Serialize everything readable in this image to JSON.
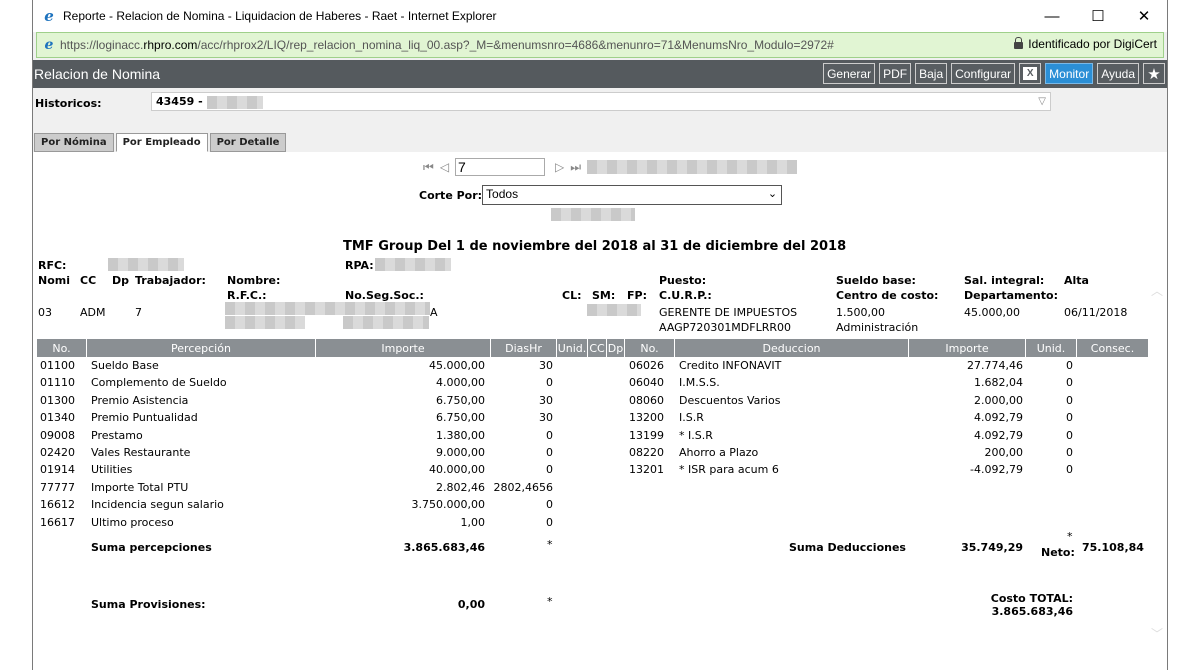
{
  "window": {
    "title": "Reporte - Relacion de Nomina - Liquidacion de Haberes - Raet - Internet Explorer",
    "url_prefix": "https://loginacc.",
    "url_domain": "rhpro.com",
    "url_rest": "/acc/rhprox2/LIQ/rep_relacion_nomina_liq_00.asp?_M=&menumsnro=4686&menunro=71&MenumsNro_Modulo=2972#",
    "secure_label": "Identificado por DigiCert",
    "minimize": "—",
    "maximize": "☐",
    "close": "✕"
  },
  "header": {
    "title": "Relacion de Nomina",
    "buttons": {
      "generar": "Generar",
      "pdf": "PDF",
      "baja": "Baja",
      "configurar": "Configurar",
      "excel": "X",
      "monitor": "Monitor",
      "ayuda": "Ayuda",
      "star": "★"
    }
  },
  "historicos": {
    "label": "Historicos:",
    "value": "43459 -"
  },
  "tabs": [
    "Por Nómina",
    "Por Empleado",
    "Por Detalle"
  ],
  "pager": {
    "first": "⏮",
    "prev": "◁",
    "page": "7",
    "next": "▷",
    "last": "⏭"
  },
  "corte": {
    "label": "Corte Por:",
    "value": "Todos"
  },
  "report": {
    "title": "TMF Group Del 1 de noviembre del 2018 al 31 de diciembre del 2018",
    "rfc_label": "RFC:",
    "rpa_label": "RPA:",
    "nomi": "Nomi",
    "cc": "CC",
    "dp": "Dp",
    "trabajador": "Trabajador:",
    "nombre": "Nombre:",
    "rfc2": "R.F.C.:",
    "noseg": "No.Seg.Soc.:",
    "cl": "CL:",
    "sm": "SM:",
    "fp": "FP:",
    "puesto": "Puesto:",
    "curp": "C.U.R.P.:",
    "sueldo_base": "Sueldo base:",
    "centro_costo": "Centro de costo:",
    "sal_integral": "Sal. integral:",
    "departamento": "Departamento:",
    "alta": "Alta",
    "emp_nomi": "03",
    "emp_cc": "ADM",
    "emp_dp": "7",
    "emp_nss_suffix": "A",
    "emp_puesto": "GERENTE DE IMPUESTOS",
    "emp_curp": "AAGP720301MDFLRR00",
    "emp_sueldo": "1.500,00",
    "emp_centro": "Administración",
    "emp_sal_integral": "45.000,00",
    "emp_alta": "06/11/2018"
  },
  "columns": [
    "No.",
    "Percepción",
    "Importe",
    "DiasHr",
    "Unid.",
    "CC",
    "Dp",
    "No.",
    "Deduccion",
    "Importe",
    "Unid.",
    "Consec."
  ],
  "percepciones": [
    {
      "no": "01100",
      "desc": "Sueldo Base",
      "importe": "45.000,00",
      "dias": "30"
    },
    {
      "no": "01110",
      "desc": "Complemento de Sueldo",
      "importe": "4.000,00",
      "dias": "0"
    },
    {
      "no": "01300",
      "desc": "Premio Asistencia",
      "importe": "6.750,00",
      "dias": "30"
    },
    {
      "no": "01340",
      "desc": "Premio Puntualidad",
      "importe": "6.750,00",
      "dias": "30"
    },
    {
      "no": "09008",
      "desc": "Prestamo",
      "importe": "1.380,00",
      "dias": "0"
    },
    {
      "no": "02420",
      "desc": "Vales Restaurante",
      "importe": "9.000,00",
      "dias": "0"
    },
    {
      "no": "01914",
      "desc": "Utilities",
      "importe": "40.000,00",
      "dias": "0"
    },
    {
      "no": "77777",
      "desc": "Importe Total PTU",
      "importe": "2.802,46",
      "dias": "2802,4656"
    },
    {
      "no": "16612",
      "desc": "Incidencia segun salario",
      "importe": "3.750.000,00",
      "dias": "0"
    },
    {
      "no": "16617",
      "desc": "Ultimo proceso",
      "importe": "1,00",
      "dias": "0"
    }
  ],
  "deducciones": [
    {
      "no": "06026",
      "desc": "Credito INFONAVIT",
      "importe": "27.774,46",
      "unid": "0"
    },
    {
      "no": "06040",
      "desc": "I.M.S.S.",
      "importe": "1.682,04",
      "unid": "0"
    },
    {
      "no": "08060",
      "desc": "Descuentos Varios",
      "importe": "2.000,00",
      "unid": "0"
    },
    {
      "no": "13200",
      "desc": "I.S.R",
      "importe": "4.092,79",
      "unid": "0"
    },
    {
      "no": "13199",
      "desc": "* I.S.R",
      "importe": "4.092,79",
      "unid": "0"
    },
    {
      "no": "08220",
      "desc": "Ahorro a Plazo",
      "importe": "200,00",
      "unid": "0"
    },
    {
      "no": "13201",
      "desc": "* ISR para acum 6",
      "importe": "-4.092,79",
      "unid": "0"
    }
  ],
  "totals": {
    "suma_perc_label": "Suma percepciones",
    "suma_perc": "3.865.683,46",
    "star": "*",
    "suma_ded_label": "Suma Deducciones",
    "suma_ded": "35.749,29",
    "neto_label": "Neto:",
    "neto": "75.108,84",
    "suma_prov_label": "Suma Provisiones:",
    "suma_prov": "0,00",
    "costo_label": "Costo TOTAL:",
    "costo": "3.865.683,46"
  }
}
